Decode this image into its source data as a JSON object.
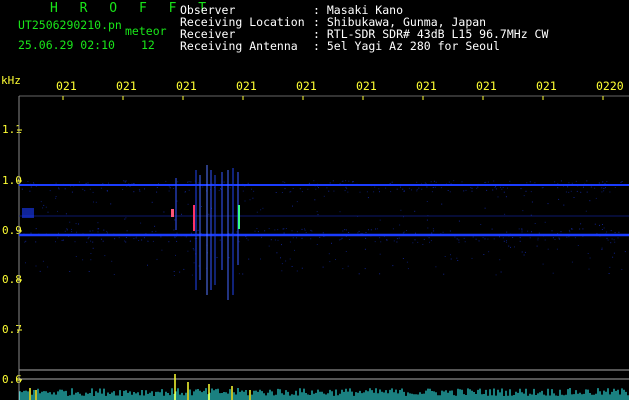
{
  "header": {
    "program": "H R O F F T",
    "filename": "UT2506290210.pn",
    "meteor_label": "meteor",
    "datetime": "25.06.29 02:10",
    "meteor_count": "12"
  },
  "info": [
    {
      "label": "Observer",
      "value": ": Masaki Kano"
    },
    {
      "label": "Receiving Location",
      "value": ": Shibukawa, Gunma, Japan"
    },
    {
      "label": "Receiver",
      "value": ": RTL-SDR SDR# 43dB L15 96.7MHz CW"
    },
    {
      "label": "Receiving Antenna",
      "value": ": 5el Yagi Az 280 for Seoul"
    }
  ],
  "axes": {
    "y_unit": "kHz",
    "y_ticks": [
      "1.1",
      "1.0",
      "0.9",
      "0.8",
      "0.7",
      "0.6"
    ],
    "x_ticks": [
      "021",
      "021",
      "021",
      "021",
      "021",
      "021",
      "021",
      "021",
      "021",
      "0220"
    ]
  },
  "colors": {
    "background": "#000000",
    "header_text": "#19e619",
    "info_text": "#ffffff",
    "axis_text": "#ffff33",
    "signal_line": "#1a3cff",
    "bottom_trace": "#33ffff"
  }
}
